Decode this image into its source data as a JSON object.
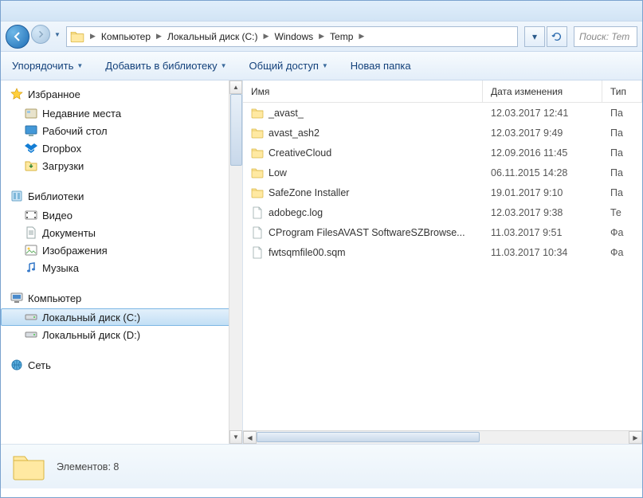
{
  "breadcrumbs": [
    "Компьютер",
    "Локальный диск (C:)",
    "Windows",
    "Temp"
  ],
  "search_placeholder": "Поиск: Tem",
  "toolbar": {
    "organize": "Упорядочить",
    "include": "Добавить в библиотеку",
    "share": "Общий доступ",
    "newfolder": "Новая папка"
  },
  "sidebar": {
    "favorites": {
      "label": "Избранное",
      "items": [
        "Недавние места",
        "Рабочий стол",
        "Dropbox",
        "Загрузки"
      ]
    },
    "libraries": {
      "label": "Библиотеки",
      "items": [
        "Видео",
        "Документы",
        "Изображения",
        "Музыка"
      ]
    },
    "computer": {
      "label": "Компьютер",
      "items": [
        "Локальный диск (C:)",
        "Локальный диск (D:)"
      ],
      "selected": 0
    },
    "network": {
      "label": "Сеть"
    }
  },
  "columns": {
    "name": "Имя",
    "date": "Дата изменения",
    "type": "Тип"
  },
  "files": [
    {
      "icon": "folder",
      "name": "_avast_",
      "date": "12.03.2017 12:41",
      "type": "Па"
    },
    {
      "icon": "folder",
      "name": "avast_ash2",
      "date": "12.03.2017 9:49",
      "type": "Па"
    },
    {
      "icon": "folder",
      "name": "CreativeCloud",
      "date": "12.09.2016 11:45",
      "type": "Па"
    },
    {
      "icon": "folder",
      "name": "Low",
      "date": "06.11.2015 14:28",
      "type": "Па"
    },
    {
      "icon": "folder",
      "name": "SafeZone Installer",
      "date": "19.01.2017 9:10",
      "type": "Па"
    },
    {
      "icon": "file",
      "name": "adobegc.log",
      "date": "12.03.2017 9:38",
      "type": "Те"
    },
    {
      "icon": "file",
      "name": "CProgram FilesAVAST SoftwareSZBrowse...",
      "date": "11.03.2017 9:51",
      "type": "Фа"
    },
    {
      "icon": "file",
      "name": "fwtsqmfile00.sqm",
      "date": "11.03.2017 10:34",
      "type": "Фа"
    }
  ],
  "status": {
    "text": "Элементов: 8"
  }
}
